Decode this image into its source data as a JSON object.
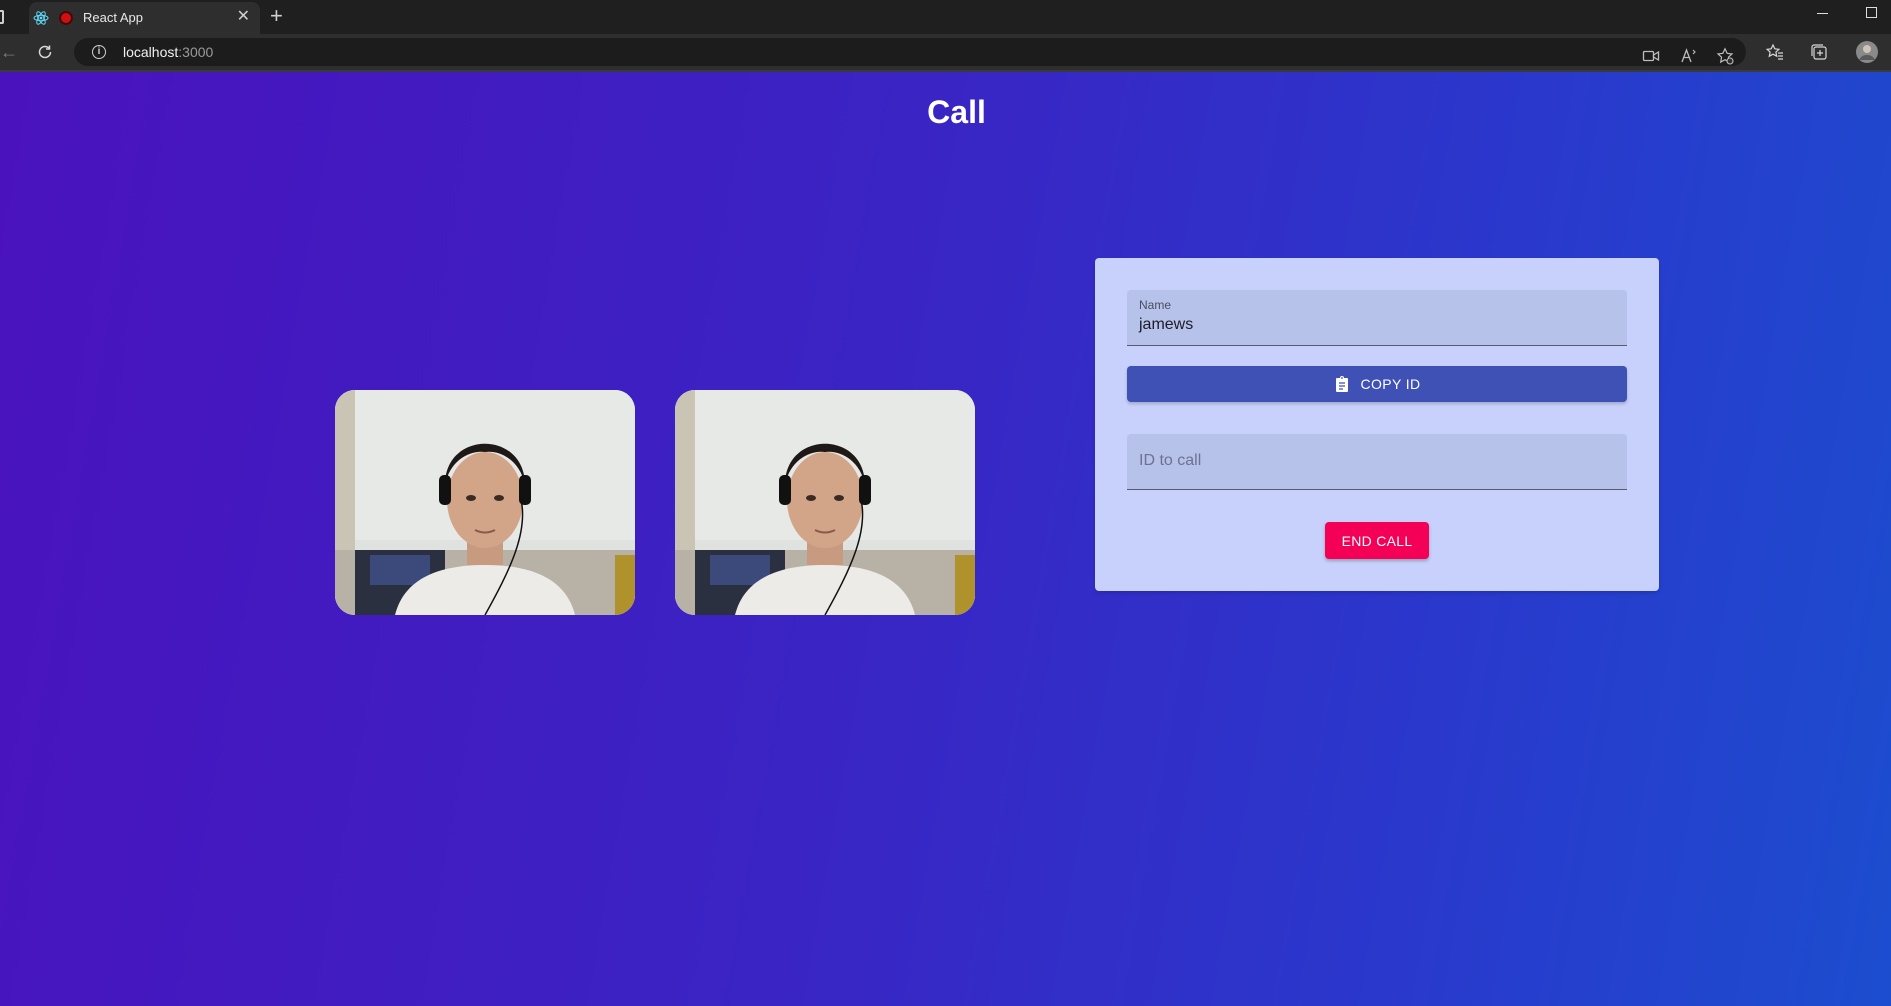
{
  "browser": {
    "tab_title": "React App",
    "tab_close": "✕",
    "new_tab": "+",
    "url_host": "localhost",
    "url_port": ":3000"
  },
  "page": {
    "title": "Call"
  },
  "videos": [
    {
      "label": "my-video"
    },
    {
      "label": "user-video"
    }
  ],
  "form": {
    "name_label": "Name",
    "name_value": "jamews",
    "copy_id_label": "COPY ID",
    "id_to_call_placeholder": "ID to call",
    "end_call_label": "END CALL"
  },
  "colors": {
    "copy_button": "#3f51b5",
    "end_button": "#f50057",
    "panel": "#c8d1fb"
  }
}
